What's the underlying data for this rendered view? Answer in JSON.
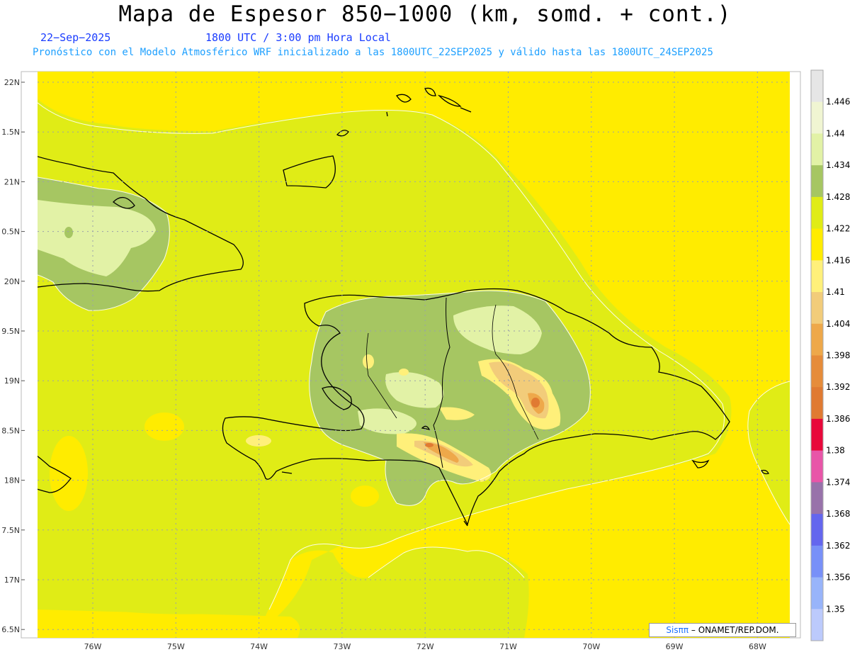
{
  "header": {
    "title": "Mapa de Espesor 850−1000 (km, somd. + cont.)",
    "date": "22−Sep−2025",
    "time": "1800 UTC / 3:00 pm Hora Local",
    "forecast": "Pronóstico con el Modelo Atmosférico WRF inicializado a las 1800UTC_22SEP2025 y válido hasta las  1800UTC_24SEP2025"
  },
  "axes": {
    "lat_labels": [
      "22N",
      "1.5N",
      "21N",
      "0.5N",
      "20N",
      "9.5N",
      "19N",
      "8.5N",
      "18N",
      "7.5N",
      "17N",
      "6.5N"
    ],
    "lon_labels": [
      "76W",
      "75W",
      "74W",
      "73W",
      "72W",
      "71W",
      "70W",
      "69W",
      "68W"
    ]
  },
  "colorbar": {
    "labels": [
      "1.446",
      "1.44",
      "1.434",
      "1.428",
      "1.422",
      "1.416",
      "1.41",
      "1.404",
      "1.398",
      "1.392",
      "1.386",
      "1.38",
      "1.374",
      "1.368",
      "1.362",
      "1.356",
      "1.35"
    ],
    "colors": [
      "#e6e6e6",
      "#f0f5d2",
      "#e2f2a6",
      "#a6c662",
      "#e0ec16",
      "#ffec00",
      "#fff07a",
      "#f2cc7a",
      "#eea84a",
      "#e68c3a",
      "#e07a32",
      "#e8083a",
      "#e855a8",
      "#9872aa",
      "#6466ee",
      "#7890f8",
      "#98b4fa",
      "#bccafc"
    ]
  },
  "map": {
    "colors": {
      "yellow": "#ffec00",
      "yellow_green": "#e0ec16",
      "green": "#a6c662",
      "pale_green": "#e2f2a6",
      "light_yellow": "#fff07a",
      "tan": "#f2cc7a",
      "orange": "#eea84a",
      "dark_orange": "#e07a32"
    }
  },
  "credit": {
    "brand": "Sisππ",
    "text": "– ONAMET/REP.DOM."
  }
}
